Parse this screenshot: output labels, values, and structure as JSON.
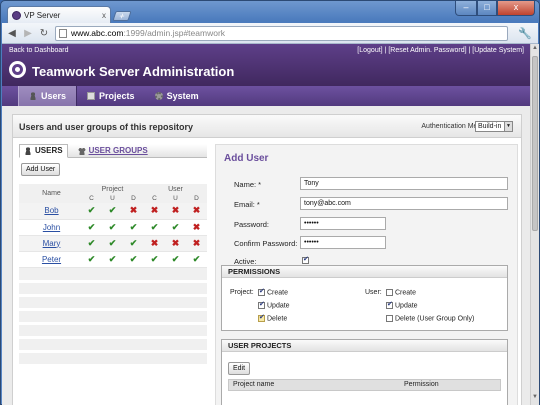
{
  "browser": {
    "tab_title": "VP Server",
    "tab_close": "x",
    "new_tab": "+",
    "url_domain": "www.abc.com",
    "url_path": ":1999/admin.jsp#teamwork",
    "win_min": "–",
    "win_max": "□",
    "win_close": "x"
  },
  "header": {
    "back_link": "Back to Dashboard",
    "logout": "[Logout]",
    "reset_password": "[Reset Admin. Password]",
    "update_system": "[Update System]",
    "sep": " | ",
    "title": "Teamwork Server Administration"
  },
  "nav": {
    "items": [
      {
        "label": "Users",
        "active": true
      },
      {
        "label": "Projects",
        "active": false
      },
      {
        "label": "System",
        "active": false
      }
    ]
  },
  "section": {
    "heading": "Users and user groups of this repository",
    "auth_label": "Authentication Method:",
    "auth_value": "Build-in"
  },
  "left": {
    "tab_users": "USERS",
    "tab_groups": "USER GROUPS",
    "add_user": "Add User",
    "col_name": "Name",
    "col_project": "Project",
    "col_user": "User",
    "perm_cols": [
      "C",
      "U",
      "D",
      "C",
      "U",
      "D"
    ],
    "users": [
      {
        "name": "Bob",
        "perms": [
          true,
          true,
          false,
          false,
          false,
          false
        ]
      },
      {
        "name": "John",
        "perms": [
          true,
          true,
          true,
          true,
          true,
          false
        ]
      },
      {
        "name": "Mary",
        "perms": [
          true,
          true,
          true,
          false,
          false,
          false
        ]
      },
      {
        "name": "Peter",
        "perms": [
          true,
          true,
          true,
          true,
          true,
          true
        ]
      }
    ]
  },
  "form": {
    "title": "Add User",
    "name_label": "Name: *",
    "name_value": "Tony",
    "email_label": "Email: *",
    "email_value": "tony@abc.com",
    "password_label": "Password:",
    "password_value": "••••••",
    "confirm_label": "Confirm Password:",
    "confirm_value": "••••••",
    "active_label": "Active:",
    "permissions_title": "PERMISSIONS",
    "project_label": "Project:",
    "user_label": "User:",
    "project_create": "Create",
    "project_update": "Update",
    "project_delete": "Delete",
    "user_create": "Create",
    "user_update": "Update",
    "user_delete": "Delete (User Group Only)",
    "projects_title": "USER PROJECTS",
    "edit": "Edit",
    "col_project_name": "Project name",
    "col_permission": "Permission"
  },
  "colors": {
    "brand_purple": "#5e3f89",
    "check_green": "#2f8a2a",
    "cross_red": "#c02020"
  }
}
